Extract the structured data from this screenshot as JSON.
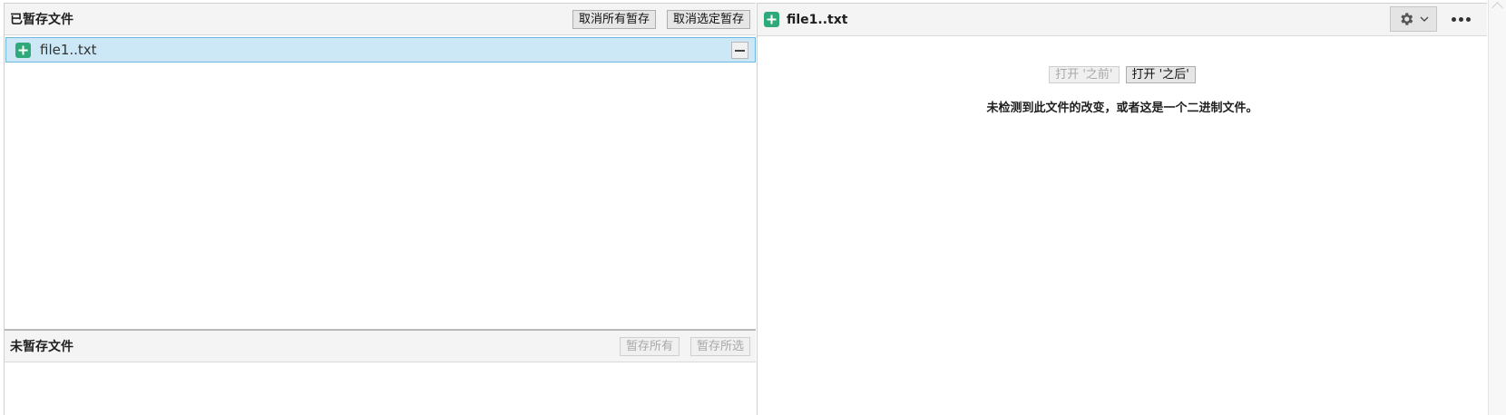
{
  "staged": {
    "title": "已暂存文件",
    "unstage_all_label": "取消所有暂存",
    "unstage_selected_label": "取消选定暂存",
    "files": [
      {
        "name": "file1..txt",
        "status": "added",
        "selected": true
      }
    ]
  },
  "unstaged": {
    "title": "未暂存文件",
    "stage_all_label": "暂存所有",
    "stage_selected_label": "暂存所选"
  },
  "diff": {
    "file_name": "file1..txt",
    "open_before_label": "打开 '之前'",
    "open_after_label": "打开 '之后'",
    "message": "未检测到此文件的改变，或者这是一个二进制文件。"
  },
  "colors": {
    "added_badge": "#2fa97a",
    "selection_bg": "#cce8f6",
    "selection_border": "#6fb6e0"
  },
  "icons": {
    "file_status": "plus-square-icon",
    "unstage": "minus-icon",
    "settings": "gear-icon",
    "dropdown": "chevron-down-icon",
    "more": "more-horizontal-icon"
  }
}
